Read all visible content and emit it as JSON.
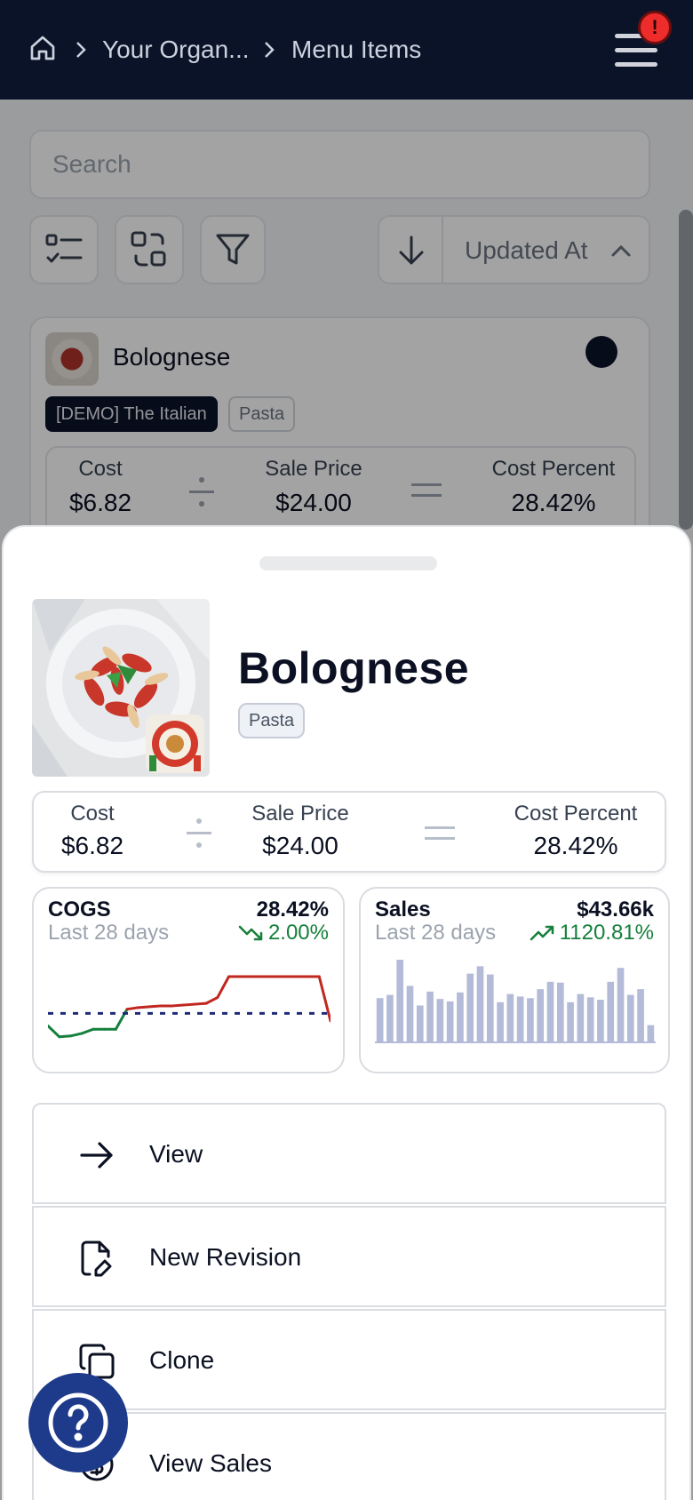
{
  "header": {
    "breadcrumb": [
      "Your Organ...",
      "Menu Items"
    ],
    "alert_badge": "!"
  },
  "toolbar": {
    "search_placeholder": "Search",
    "sort_label": "Updated At"
  },
  "list_card": {
    "title": "Bolognese",
    "tags": [
      "[DEMO] The Italian",
      "Pasta"
    ],
    "stats": {
      "cost_label": "Cost",
      "cost_value": "$6.82",
      "price_label": "Sale Price",
      "price_value": "$24.00",
      "percent_label": "Cost Percent",
      "percent_value": "28.42%"
    }
  },
  "sheet": {
    "title": "Bolognese",
    "tag": "Pasta",
    "stats": {
      "cost_label": "Cost",
      "cost_value": "$6.82",
      "price_label": "Sale Price",
      "price_value": "$24.00",
      "percent_label": "Cost Percent",
      "percent_value": "28.42%"
    },
    "cogs": {
      "title": "COGS",
      "subtitle": "Last 28 days",
      "value": "28.42%",
      "delta": "2.00%",
      "delta_direction": "down",
      "color_line": "#c0271e",
      "color_below": "#15803d",
      "color_target": "#1e2a78"
    },
    "sales": {
      "title": "Sales",
      "subtitle": "Last 28 days",
      "value": "$43.66k",
      "delta": "1120.81%",
      "delta_direction": "up",
      "bar_color": "#b4bbd8"
    },
    "actions": [
      {
        "label": "View",
        "icon": "arrow-right-icon"
      },
      {
        "label": "New Revision",
        "icon": "file-edit-icon"
      },
      {
        "label": "Clone",
        "icon": "copy-icon"
      },
      {
        "label": "View Sales",
        "icon": "sales-icon"
      }
    ]
  },
  "chart_data": [
    {
      "type": "line",
      "title": "COGS",
      "series": [
        {
          "values": [
            24.5,
            23.2,
            23.3,
            23.6,
            24.1,
            24.1,
            24.1,
            26.5,
            26.7,
            26.8,
            26.9,
            26.9,
            27.0,
            27.1,
            27.2,
            27.9,
            30.4,
            30.4,
            30.4,
            30.4,
            30.4,
            30.4,
            30.4,
            30.4,
            30.4,
            25.1
          ]
        }
      ],
      "target": 26.0,
      "ylim": [
        22,
        32
      ]
    },
    {
      "type": "bar",
      "title": "Sales",
      "values": [
        53,
        57,
        100,
        68,
        44,
        61,
        52,
        49,
        60,
        83,
        92,
        82,
        48,
        58,
        55,
        53,
        64,
        73,
        72,
        48,
        58,
        54,
        51,
        73,
        90,
        57,
        64,
        20
      ],
      "ylim": [
        0,
        100
      ]
    }
  ]
}
